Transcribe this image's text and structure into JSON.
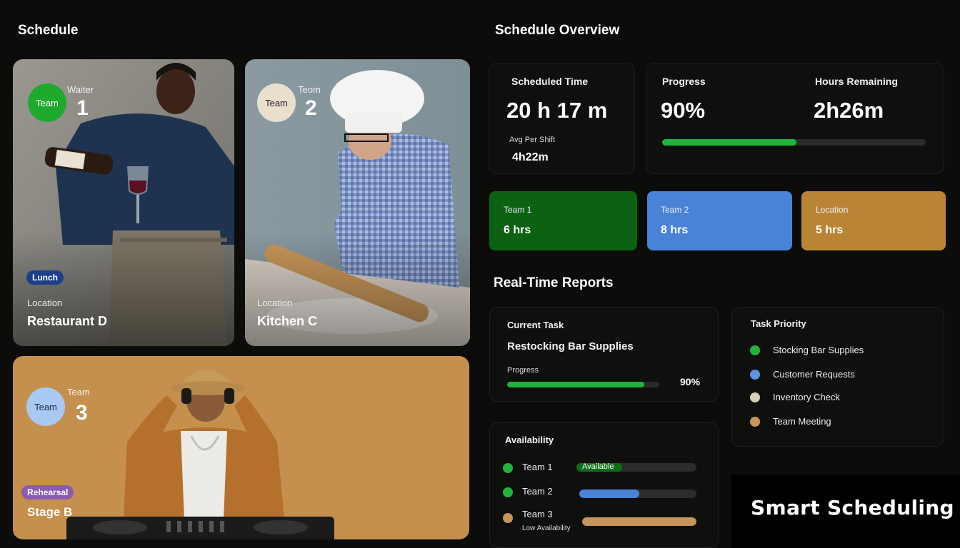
{
  "schedule": {
    "title": "Schedule",
    "cards": [
      {
        "badge": "Team",
        "caption": "Waiter",
        "number": "1",
        "pill": "Lunch",
        "location_caption": "Location",
        "location": "Restaurant D"
      },
      {
        "badge": "Team",
        "caption": "Teom",
        "number": "2",
        "location_caption": "Location",
        "location": "Kitchen C"
      },
      {
        "badge": "Team",
        "caption": "Team",
        "number": "3",
        "pill": "Rehearsal",
        "location": "Stage B"
      }
    ]
  },
  "overview": {
    "title": "Schedule Overview",
    "scheduled_time_label": "Scheduled Time",
    "scheduled_time_value": "20 h 17 m",
    "avg_label": "Avg Per Shift",
    "avg_value": "4h22m",
    "progress_label": "Progress",
    "progress_value": "90%",
    "progress_fraction": 0.51,
    "hours_remaining_label": "Hours Remaining",
    "hours_remaining_value": "2h26m",
    "tiles": [
      {
        "label": "Team 1",
        "value": "6 hrs",
        "color": "#0c6112"
      },
      {
        "label": "Team 2",
        "value": "8 hrs",
        "color": "#4a83d6"
      },
      {
        "label": "Location",
        "value": "5 hrs",
        "color": "#b98535"
      }
    ]
  },
  "reports": {
    "title": "Real-Time Reports",
    "current_task_label": "Current Task",
    "current_task_value": "Restocking Bar Supplies",
    "task_progress_label": "Progress",
    "task_progress_value": "90%",
    "task_progress_fraction": 0.9,
    "priority_title": "Task Priority",
    "priorities": [
      {
        "label": "Stocking Bar Supplies",
        "color": "#22b33c"
      },
      {
        "label": "Customer Requests",
        "color": "#5b95e0"
      },
      {
        "label": "Inventory Check",
        "color": "#d8cdb6"
      },
      {
        "label": "Team Meeting",
        "color": "#c6955a"
      }
    ],
    "availability_title": "Availability",
    "availability": [
      {
        "label": "Team 1",
        "status": "Available",
        "fraction": 0.38,
        "color": "#0f6d18",
        "dot": "#22b33c"
      },
      {
        "label": "Team 2",
        "status": "",
        "fraction": 0.51,
        "color": "#4a83d6",
        "dot": "#22b33c"
      },
      {
        "label": "Team 3",
        "sub": "Low Availability",
        "fraction": 1.0,
        "color": "#c6955a",
        "dot": "#c6955a"
      }
    ]
  },
  "brand": {
    "text": "Smart Scheduling"
  },
  "colors": {
    "accent_green": "#22b33c",
    "background": "#0c0c0b"
  }
}
